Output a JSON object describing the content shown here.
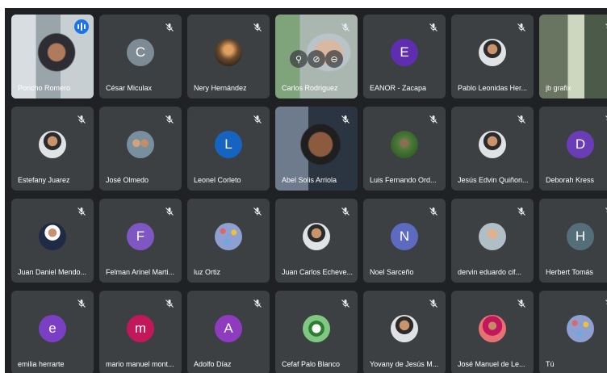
{
  "colors": {
    "stage_bg": "#202124",
    "tile_bg": "#3c4043",
    "active_outline": "#8ab4f8",
    "speaking_badge": "#1a73e8"
  },
  "participants": [
    {
      "name": "Poncho Romero",
      "kind": "video",
      "speaking": true,
      "active": true
    },
    {
      "name": "César Miculax",
      "kind": "letter",
      "initial": "C",
      "color": "#7d8c94"
    },
    {
      "name": "Nery Hernández",
      "kind": "photo-avatar",
      "photo": "sunset"
    },
    {
      "name": "Carlos Rodriguez",
      "kind": "video",
      "hover_controls": true
    },
    {
      "name": "EANOR - Zacapa",
      "kind": "letter",
      "initial": "E",
      "color": "#5f2eb0"
    },
    {
      "name": "Pablo Leonidas Her...",
      "kind": "photo-avatar",
      "photo": "person"
    },
    {
      "name": "jb grafix",
      "kind": "video"
    },
    {
      "name": "Estefany Juarez",
      "kind": "photo-avatar",
      "photo": "person"
    },
    {
      "name": "José Olmedo",
      "kind": "photo-avatar",
      "photo": "group"
    },
    {
      "name": "Leonel Corleto",
      "kind": "letter",
      "initial": "L",
      "color": "#1565c0"
    },
    {
      "name": "Abel Solis Arriola",
      "kind": "video"
    },
    {
      "name": "Luis Fernando Ord...",
      "kind": "photo-avatar",
      "photo": "outdoor"
    },
    {
      "name": "Jesús Edvin Quiñon...",
      "kind": "photo-avatar",
      "photo": "person"
    },
    {
      "name": "Deborah Kress",
      "kind": "letter",
      "initial": "D",
      "color": "#6a3db6"
    },
    {
      "name": "Juan Daniel Mendo...",
      "kind": "photo-avatar",
      "photo": "suit"
    },
    {
      "name": "Felman Arinel Marti...",
      "kind": "letter",
      "initial": "F",
      "color": "#7e57c2"
    },
    {
      "name": "luz Ortiz",
      "kind": "photo-avatar",
      "photo": "pattern"
    },
    {
      "name": "Juan Carlos Echeve...",
      "kind": "photo-avatar",
      "photo": "person"
    },
    {
      "name": "Noel Sarceño",
      "kind": "letter",
      "initial": "N",
      "color": "#5c6bc0"
    },
    {
      "name": "dervin eduardo cif...",
      "kind": "photo-avatar",
      "photo": "child"
    },
    {
      "name": "Herbert Tomás",
      "kind": "letter",
      "initial": "H",
      "color": "#546e7a"
    },
    {
      "name": "emilia herrarte",
      "kind": "letter",
      "initial": "e",
      "color": "#7b3fc4"
    },
    {
      "name": "mario manuel mont...",
      "kind": "letter",
      "initial": "m",
      "color": "#c2185b"
    },
    {
      "name": "Adolfo Díaz",
      "kind": "letter",
      "initial": "A",
      "color": "#8e3bbf"
    },
    {
      "name": "Cefaf Palo Blanco",
      "kind": "photo-avatar",
      "photo": "logo"
    },
    {
      "name": "Yovany de Jesús M...",
      "kind": "photo-avatar",
      "photo": "person"
    },
    {
      "name": "José Manuel de Le...",
      "kind": "photo-avatar",
      "photo": "red"
    },
    {
      "name": "Tú",
      "kind": "photo-avatar",
      "photo": "pattern"
    }
  ]
}
